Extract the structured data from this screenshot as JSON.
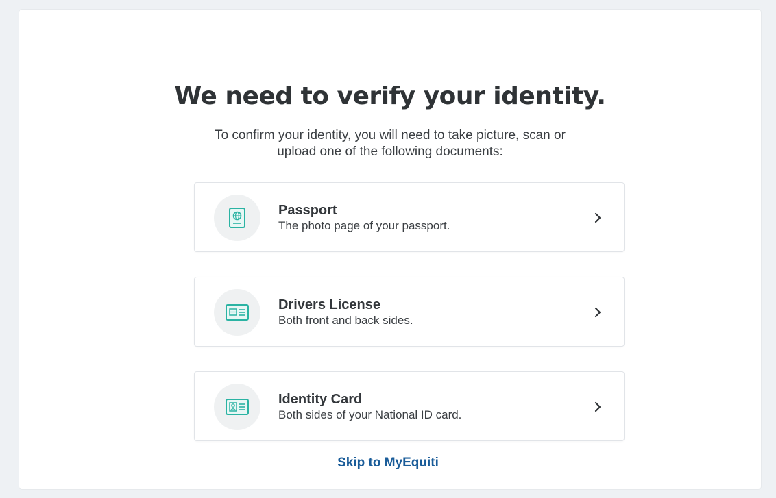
{
  "header": {
    "title": "We need to verify your identity.",
    "subtitle_line1": "To confirm your identity, you will need to take picture, scan or",
    "subtitle_line2": "upload one of the following documents:"
  },
  "documents": [
    {
      "title": "Passport",
      "description": "The photo page of your passport.",
      "icon": "passport-icon"
    },
    {
      "title": "Drivers License",
      "description": "Both front and back sides.",
      "icon": "drivers-license-icon"
    },
    {
      "title": "Identity Card",
      "description": "Both sides of your National ID card.",
      "icon": "id-card-icon"
    }
  ],
  "footer": {
    "skip_label": "Skip to MyEquiti"
  },
  "colors": {
    "accent_teal": "#2bb3a3",
    "link_blue": "#1a5c99",
    "icon_bg": "#eff1f2"
  }
}
